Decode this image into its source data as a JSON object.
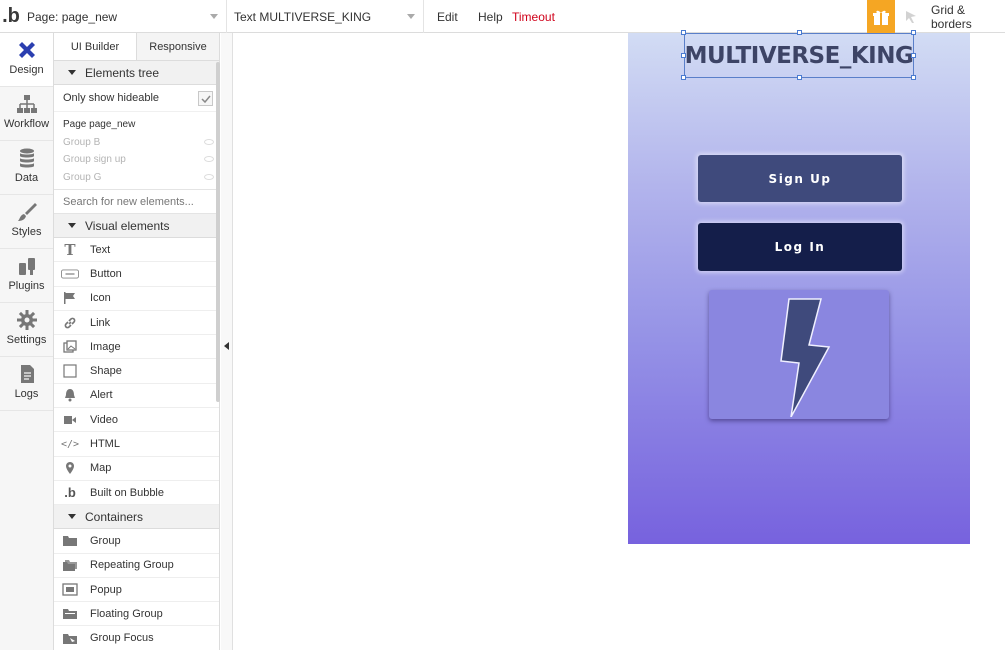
{
  "topbar": {
    "logo": ".b",
    "page_select": "Page: page_new",
    "element_select": "Text MULTIVERSE_KING",
    "edit": "Edit",
    "help": "Help",
    "timeout": "Timeout",
    "grid": "Grid & borders",
    "timeout_color": "#d0021b",
    "gift_color": "#f5a623"
  },
  "sidebar": {
    "tabs": [
      {
        "label": "Design",
        "icon": "design-icon",
        "active": true
      },
      {
        "label": "Workflow",
        "icon": "workflow-icon"
      },
      {
        "label": "Data",
        "icon": "database-icon"
      },
      {
        "label": "Styles",
        "icon": "brush-icon"
      },
      {
        "label": "Plugins",
        "icon": "plugin-icon"
      },
      {
        "label": "Settings",
        "icon": "gear-icon"
      },
      {
        "label": "Logs",
        "icon": "document-icon"
      }
    ]
  },
  "palette": {
    "tab_builder": "UI Builder",
    "tab_responsive": "Responsive",
    "elements_tree": "Elements tree",
    "only_show_hideable": "Only show hideable",
    "tree": {
      "page": "Page page_new",
      "group_b": "Group B",
      "group_signup": "Group sign up",
      "group_g": "Group G"
    },
    "search_placeholder": "Search for new elements...",
    "visual_elements": "Visual elements",
    "items": {
      "text": "Text",
      "button": "Button",
      "icon": "Icon",
      "link": "Link",
      "image": "Image",
      "shape": "Shape",
      "alert": "Alert",
      "video": "Video",
      "html": "HTML",
      "map": "Map",
      "built_on_bubble": "Built on Bubble"
    },
    "containers": "Containers",
    "containers_items": {
      "group": "Group",
      "repeating_group": "Repeating Group",
      "popup": "Popup",
      "floating_group": "Floating Group",
      "group_focus": "Group Focus"
    }
  },
  "canvas": {
    "title": "MULTIVERSE_KING",
    "signup": "Sign Up",
    "login": "Log In",
    "signup_color": "#3f4a7c",
    "login_color": "#141e4a"
  }
}
